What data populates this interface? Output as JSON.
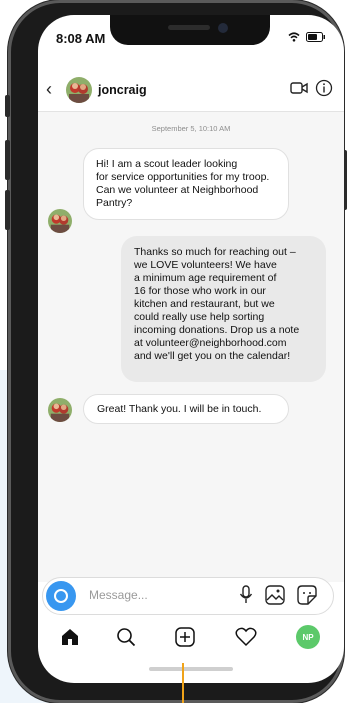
{
  "status_bar": {
    "time": "8:08 AM"
  },
  "header": {
    "username": "joncraig"
  },
  "chat": {
    "date": "September 5, 10:10 AM",
    "messages": [
      {
        "from": "joncraig",
        "text": "Hi! I am a scout leader looking\nfor service opportunities for my troop.\nCan we volunteer at Neighborhood\nPantry?"
      },
      {
        "from": "me",
        "text": "Thanks so much for reaching out –\nwe LOVE volunteers! We have\na minimum age requirement of\n16 for those who work in our\nkitchen and restaurant, but we\ncould really use help sorting\nincoming donations. Drop us a note\nat volunteer@neighborhood.com\nand we'll get you on the calendar!"
      },
      {
        "from": "joncraig",
        "text": "Great! Thank you. I will be in touch."
      }
    ]
  },
  "composer": {
    "placeholder": "Message..."
  },
  "nav": {
    "profile_initials": "NP"
  },
  "colors": {
    "accent_blue": "#3897f0",
    "profile_green": "#5cc96a",
    "pointer_orange": "#f0a319"
  }
}
